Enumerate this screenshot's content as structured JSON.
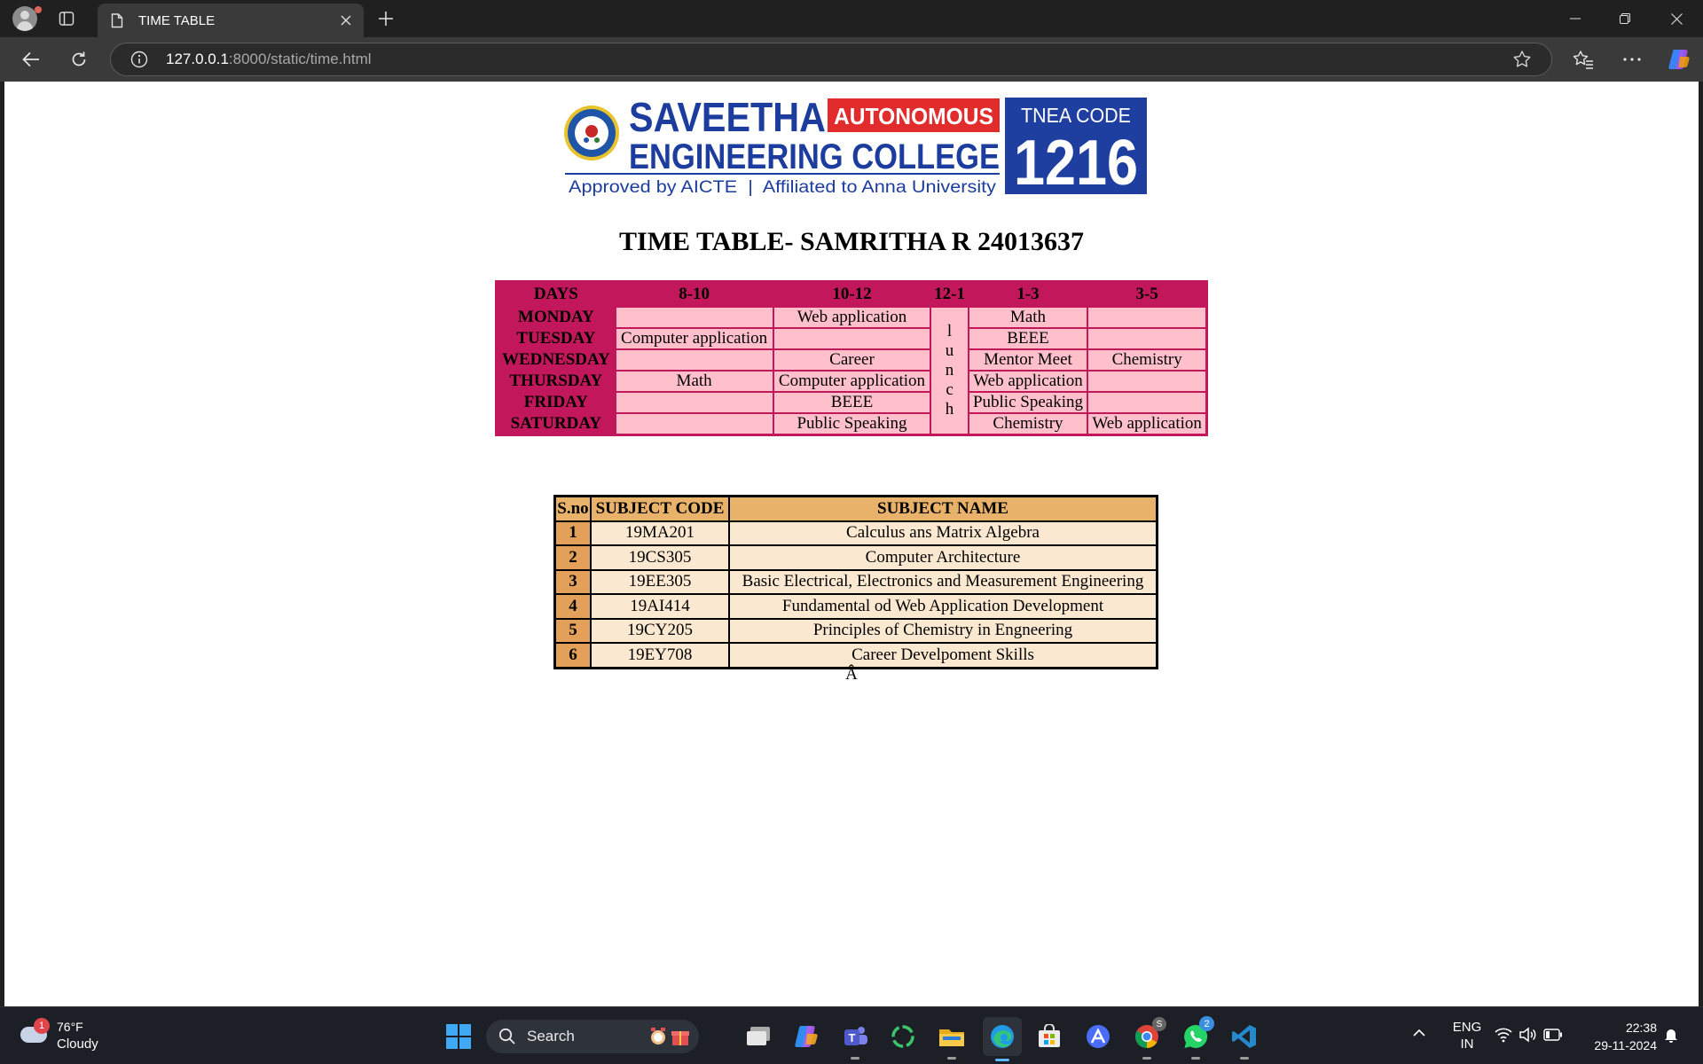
{
  "browser": {
    "tab_title": "TIME TABLE",
    "url_host": "127.0.0.1",
    "url_rest": ":8000/static/time.html"
  },
  "logo": {
    "name_line1": "SAVEETHA",
    "name_line2": "ENGINEERING COLLEGE",
    "badge": "AUTONOMOUS",
    "approval": "Approved by AICTE  |  Affiliated to Anna University",
    "tnea_label": "TNEA CODE",
    "tnea_code": "1216"
  },
  "page": {
    "title": "TIME TABLE- SAMRITHA R 24013637",
    "stray_char": "Â"
  },
  "timetable": {
    "headers": [
      "DAYS",
      "8-10",
      "10-12",
      "12-1",
      "1-3",
      "3-5"
    ],
    "lunch_letters": [
      "l",
      "u",
      "n",
      "c",
      "h"
    ],
    "rows": [
      {
        "day": "MONDAY",
        "s1": "",
        "s2": "Web application",
        "s4": "Math",
        "s5": ""
      },
      {
        "day": "TUESDAY",
        "s1": "Computer application",
        "s2": "",
        "s4": "BEEE",
        "s5": ""
      },
      {
        "day": "WEDNESDAY",
        "s1": "",
        "s2": "Career",
        "s4": "Mentor Meet",
        "s5": "Chemistry"
      },
      {
        "day": "THURSDAY",
        "s1": "Math",
        "s2": "Computer application",
        "s4": "Web application",
        "s5": ""
      },
      {
        "day": "FRIDAY",
        "s1": "",
        "s2": "BEEE",
        "s4": "Public Speaking",
        "s5": ""
      },
      {
        "day": "SATURDAY",
        "s1": "",
        "s2": "Public Speaking",
        "s4": "Chemistry",
        "s5": "Web application"
      }
    ]
  },
  "subjects": {
    "headers": [
      "S.no",
      "SUBJECT CODE",
      "SUBJECT NAME"
    ],
    "rows": [
      {
        "sno": "1",
        "code": "19MA201",
        "name": "Calculus ans Matrix Algebra"
      },
      {
        "sno": "2",
        "code": "19CS305",
        "name": "Computer Architecture"
      },
      {
        "sno": "3",
        "code": "19EE305",
        "name": "Basic Electrical, Electronics and Measurement Engineering"
      },
      {
        "sno": "4",
        "code": "19AI414",
        "name": "Fundamental od Web Application Development"
      },
      {
        "sno": "5",
        "code": "19CY205",
        "name": "Principles of Chemistry in Engneering"
      },
      {
        "sno": "6",
        "code": "19EY708",
        "name": "Career Develpoment Skills"
      }
    ]
  },
  "taskbar": {
    "weather_temp": "76°F",
    "weather_cond": "Cloudy",
    "weather_badge": "1",
    "search_label": "Search",
    "chrome_badge": "S",
    "whatsapp_badge": "2",
    "lang_top": "ENG",
    "lang_bottom": "IN",
    "time": "22:38",
    "date": "29-11-2024"
  },
  "colors": {
    "timetable_accent": "#c2185b",
    "timetable_cell": "#ffc0cb",
    "subject_header": "#e9b26a",
    "subject_cell": "#fbe8d0"
  },
  "icons": [
    "profile-avatar",
    "tab-actions-icon",
    "page-icon",
    "close-icon",
    "plus-icon",
    "minimize-icon",
    "restore-icon",
    "back-arrow-icon",
    "reload-icon",
    "info-icon",
    "star-icon",
    "favorites-icon",
    "more-icon",
    "copilot-icon",
    "windows-start-icon",
    "search-icon",
    "task-view-icon",
    "teams-icon",
    "explorer-icon",
    "edge-icon",
    "store-icon",
    "chrome-icon",
    "whatsapp-icon",
    "vscode-icon",
    "wifi-icon",
    "volume-icon",
    "battery-icon",
    "bell-icon"
  ]
}
